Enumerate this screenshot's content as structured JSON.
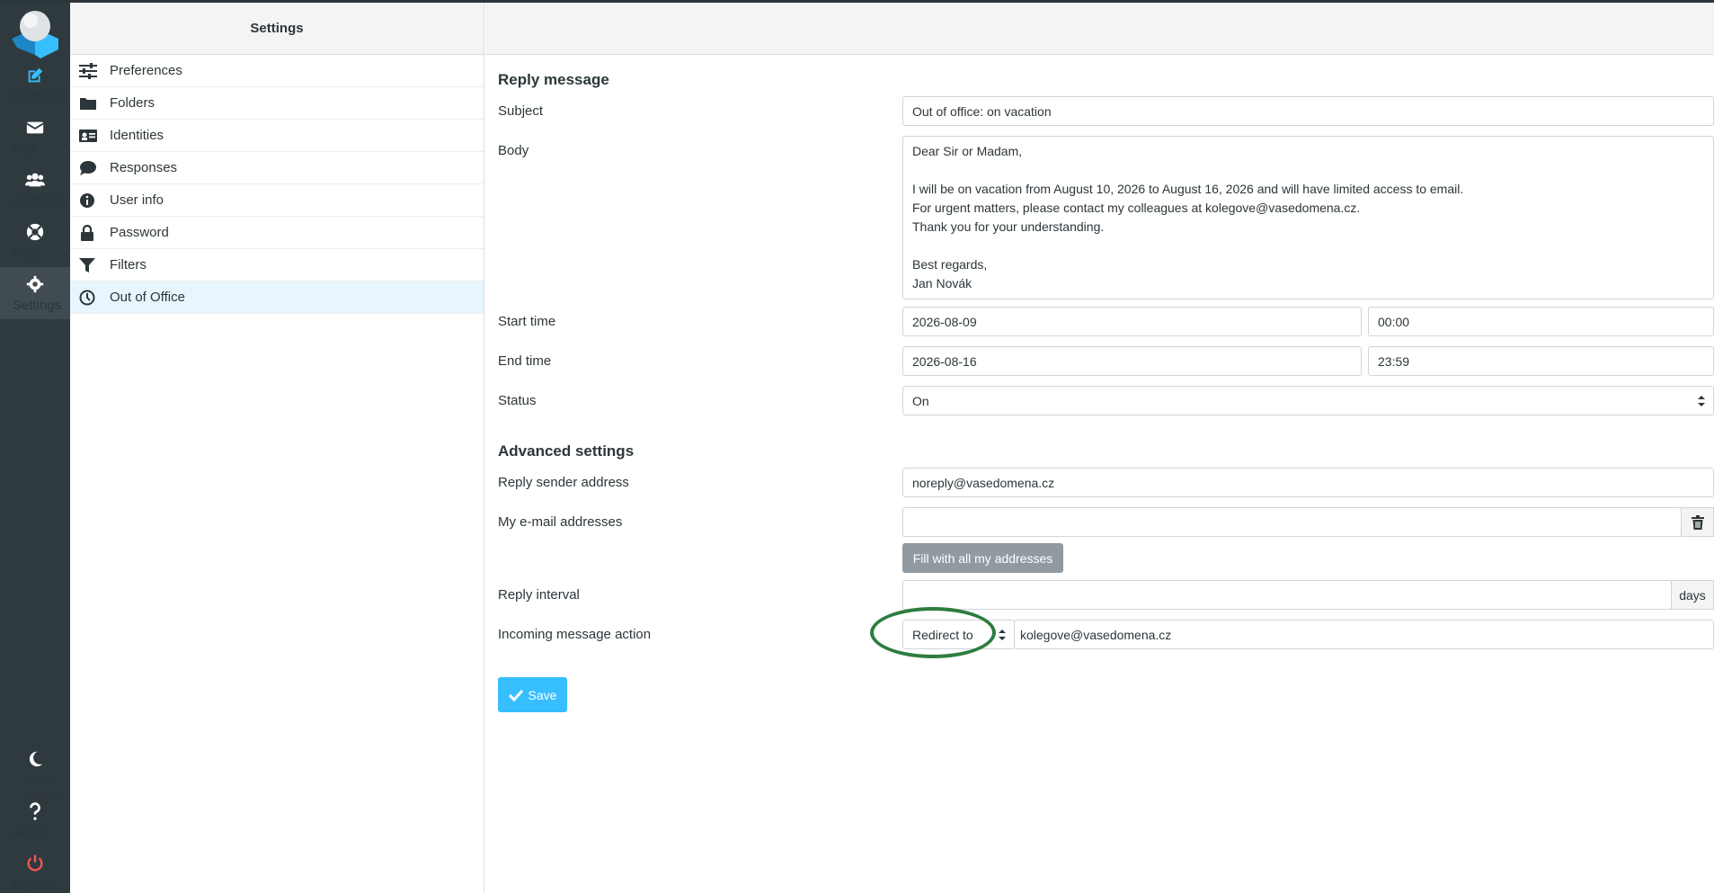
{
  "nav": {
    "compose": "Compose",
    "mail": "Mail",
    "contacts": "Contacts",
    "help": "Help",
    "settings": "Settings",
    "dark_mode": "Dark mode",
    "about": "About",
    "logout": "Logout"
  },
  "settings_list": {
    "title": "Settings",
    "items": [
      {
        "label": "Preferences",
        "icon": "sliders-icon"
      },
      {
        "label": "Folders",
        "icon": "folder-icon"
      },
      {
        "label": "Identities",
        "icon": "id-card-icon"
      },
      {
        "label": "Responses",
        "icon": "comment-icon"
      },
      {
        "label": "User info",
        "icon": "info-icon"
      },
      {
        "label": "Password",
        "icon": "lock-icon"
      },
      {
        "label": "Filters",
        "icon": "filter-icon"
      },
      {
        "label": "Out of Office",
        "icon": "clock-icon"
      }
    ]
  },
  "form": {
    "reply_title": "Reply message",
    "subject_label": "Subject",
    "subject_value": "Out of office: on vacation",
    "body_label": "Body",
    "body_value": "Dear Sir or Madam,\n\nI will be on vacation from August 10, 2026 to August 16, 2026 and will have limited access to email.\nFor urgent matters, please contact my colleagues at kolegove@vasedomena.cz.\nThank you for your understanding.\n\nBest regards,\nJan Novák",
    "start_label": "Start time",
    "start_date": "2026-08-09",
    "start_time": "00:00",
    "end_label": "End time",
    "end_date": "2026-08-16",
    "end_time": "23:59",
    "status_label": "Status",
    "status_value": "On",
    "advanced_title": "Advanced settings",
    "sender_label": "Reply sender address",
    "sender_value": "noreply@vasedomena.cz",
    "my_emails_label": "My e-mail addresses",
    "my_emails_value": "",
    "fill_button": "Fill with all my addresses",
    "interval_label": "Reply interval",
    "interval_value": "",
    "interval_unit": "days",
    "action_label": "Incoming message action",
    "action_value": "Redirect to",
    "action_target": "kolegove@vasedomena.cz",
    "save_button": "Save"
  },
  "colors": {
    "accent": "#37beff",
    "nav_bg": "#2f3a3f",
    "logout": "#ff5552",
    "annotation": "#2e7d3e"
  }
}
